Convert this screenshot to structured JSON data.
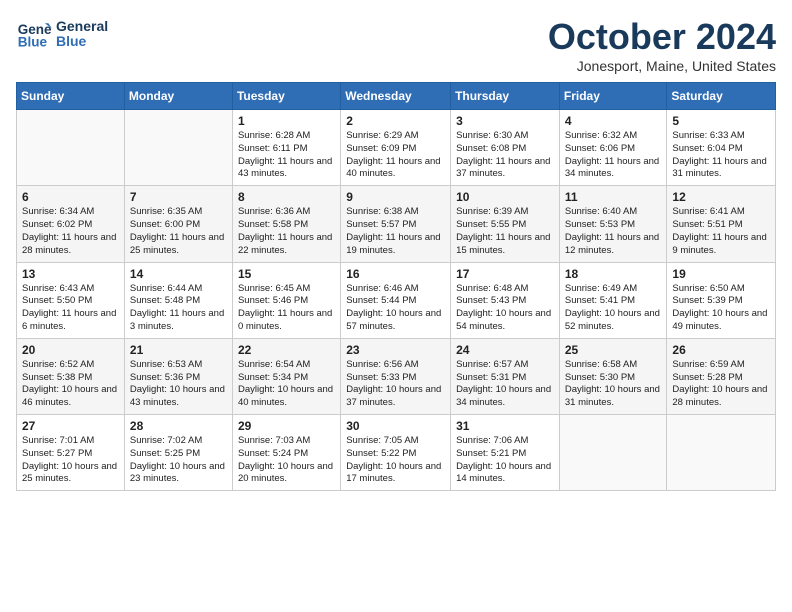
{
  "header": {
    "logo_line1": "General",
    "logo_line2": "Blue",
    "title": "October 2024",
    "subtitle": "Jonesport, Maine, United States"
  },
  "columns": [
    "Sunday",
    "Monday",
    "Tuesday",
    "Wednesday",
    "Thursday",
    "Friday",
    "Saturday"
  ],
  "weeks": [
    [
      {
        "num": "",
        "content": ""
      },
      {
        "num": "",
        "content": ""
      },
      {
        "num": "1",
        "content": "Sunrise: 6:28 AM\nSunset: 6:11 PM\nDaylight: 11 hours and 43 minutes."
      },
      {
        "num": "2",
        "content": "Sunrise: 6:29 AM\nSunset: 6:09 PM\nDaylight: 11 hours and 40 minutes."
      },
      {
        "num": "3",
        "content": "Sunrise: 6:30 AM\nSunset: 6:08 PM\nDaylight: 11 hours and 37 minutes."
      },
      {
        "num": "4",
        "content": "Sunrise: 6:32 AM\nSunset: 6:06 PM\nDaylight: 11 hours and 34 minutes."
      },
      {
        "num": "5",
        "content": "Sunrise: 6:33 AM\nSunset: 6:04 PM\nDaylight: 11 hours and 31 minutes."
      }
    ],
    [
      {
        "num": "6",
        "content": "Sunrise: 6:34 AM\nSunset: 6:02 PM\nDaylight: 11 hours and 28 minutes."
      },
      {
        "num": "7",
        "content": "Sunrise: 6:35 AM\nSunset: 6:00 PM\nDaylight: 11 hours and 25 minutes."
      },
      {
        "num": "8",
        "content": "Sunrise: 6:36 AM\nSunset: 5:58 PM\nDaylight: 11 hours and 22 minutes."
      },
      {
        "num": "9",
        "content": "Sunrise: 6:38 AM\nSunset: 5:57 PM\nDaylight: 11 hours and 19 minutes."
      },
      {
        "num": "10",
        "content": "Sunrise: 6:39 AM\nSunset: 5:55 PM\nDaylight: 11 hours and 15 minutes."
      },
      {
        "num": "11",
        "content": "Sunrise: 6:40 AM\nSunset: 5:53 PM\nDaylight: 11 hours and 12 minutes."
      },
      {
        "num": "12",
        "content": "Sunrise: 6:41 AM\nSunset: 5:51 PM\nDaylight: 11 hours and 9 minutes."
      }
    ],
    [
      {
        "num": "13",
        "content": "Sunrise: 6:43 AM\nSunset: 5:50 PM\nDaylight: 11 hours and 6 minutes."
      },
      {
        "num": "14",
        "content": "Sunrise: 6:44 AM\nSunset: 5:48 PM\nDaylight: 11 hours and 3 minutes."
      },
      {
        "num": "15",
        "content": "Sunrise: 6:45 AM\nSunset: 5:46 PM\nDaylight: 11 hours and 0 minutes."
      },
      {
        "num": "16",
        "content": "Sunrise: 6:46 AM\nSunset: 5:44 PM\nDaylight: 10 hours and 57 minutes."
      },
      {
        "num": "17",
        "content": "Sunrise: 6:48 AM\nSunset: 5:43 PM\nDaylight: 10 hours and 54 minutes."
      },
      {
        "num": "18",
        "content": "Sunrise: 6:49 AM\nSunset: 5:41 PM\nDaylight: 10 hours and 52 minutes."
      },
      {
        "num": "19",
        "content": "Sunrise: 6:50 AM\nSunset: 5:39 PM\nDaylight: 10 hours and 49 minutes."
      }
    ],
    [
      {
        "num": "20",
        "content": "Sunrise: 6:52 AM\nSunset: 5:38 PM\nDaylight: 10 hours and 46 minutes."
      },
      {
        "num": "21",
        "content": "Sunrise: 6:53 AM\nSunset: 5:36 PM\nDaylight: 10 hours and 43 minutes."
      },
      {
        "num": "22",
        "content": "Sunrise: 6:54 AM\nSunset: 5:34 PM\nDaylight: 10 hours and 40 minutes."
      },
      {
        "num": "23",
        "content": "Sunrise: 6:56 AM\nSunset: 5:33 PM\nDaylight: 10 hours and 37 minutes."
      },
      {
        "num": "24",
        "content": "Sunrise: 6:57 AM\nSunset: 5:31 PM\nDaylight: 10 hours and 34 minutes."
      },
      {
        "num": "25",
        "content": "Sunrise: 6:58 AM\nSunset: 5:30 PM\nDaylight: 10 hours and 31 minutes."
      },
      {
        "num": "26",
        "content": "Sunrise: 6:59 AM\nSunset: 5:28 PM\nDaylight: 10 hours and 28 minutes."
      }
    ],
    [
      {
        "num": "27",
        "content": "Sunrise: 7:01 AM\nSunset: 5:27 PM\nDaylight: 10 hours and 25 minutes."
      },
      {
        "num": "28",
        "content": "Sunrise: 7:02 AM\nSunset: 5:25 PM\nDaylight: 10 hours and 23 minutes."
      },
      {
        "num": "29",
        "content": "Sunrise: 7:03 AM\nSunset: 5:24 PM\nDaylight: 10 hours and 20 minutes."
      },
      {
        "num": "30",
        "content": "Sunrise: 7:05 AM\nSunset: 5:22 PM\nDaylight: 10 hours and 17 minutes."
      },
      {
        "num": "31",
        "content": "Sunrise: 7:06 AM\nSunset: 5:21 PM\nDaylight: 10 hours and 14 minutes."
      },
      {
        "num": "",
        "content": ""
      },
      {
        "num": "",
        "content": ""
      }
    ]
  ]
}
